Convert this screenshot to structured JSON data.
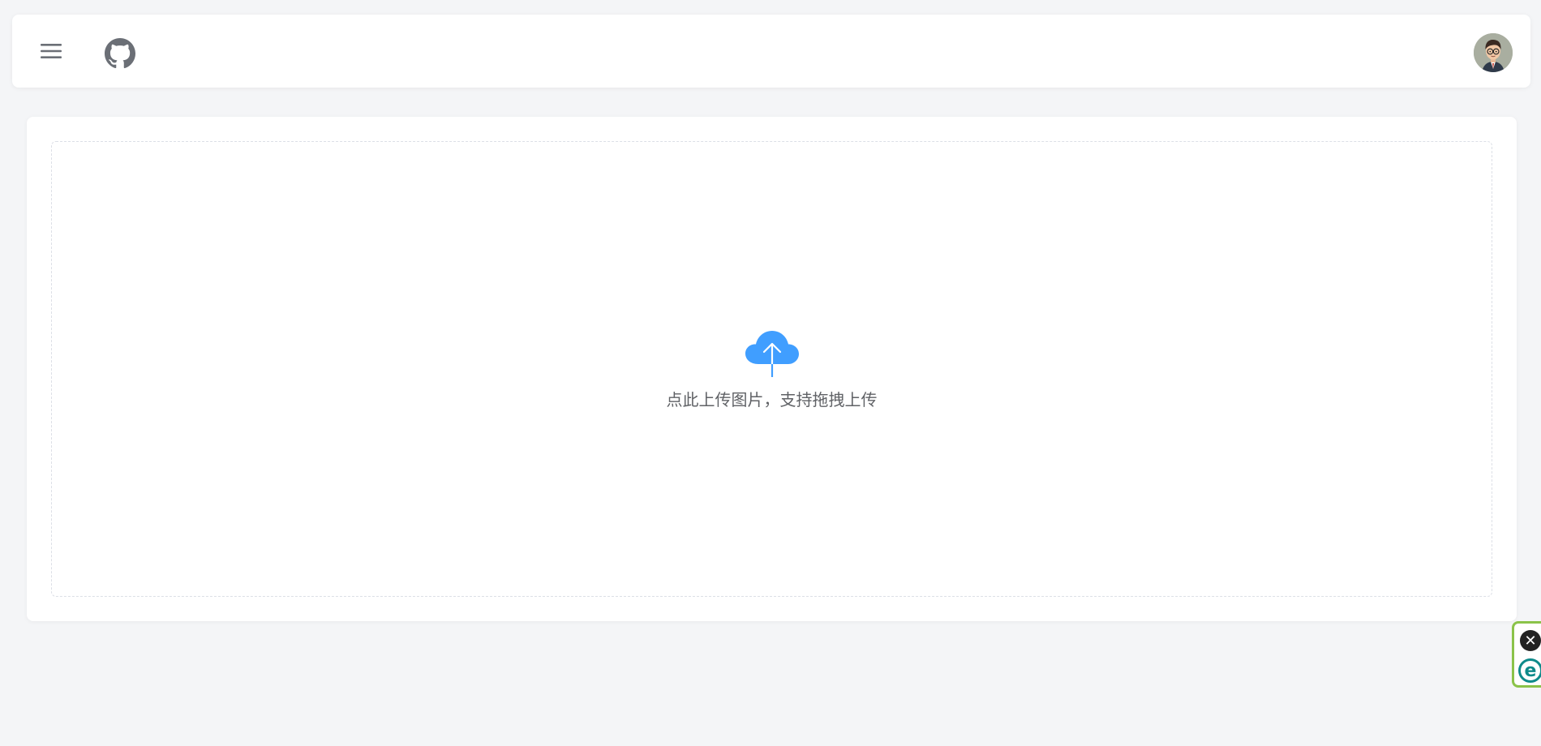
{
  "header": {
    "menu_icon": "hamburger-menu-icon",
    "github_icon": "github-icon",
    "avatar_icon": "user-avatar"
  },
  "upload": {
    "icon": "cloud-upload-icon",
    "hint": "点此上传图片，支持拖拽上传"
  },
  "extension": {
    "close_glyph": "✕",
    "logo_glyph": "e"
  },
  "colors": {
    "accent": "#409eff",
    "text": "#606266",
    "icon": "#6b6f76",
    "border": "#dcdfe6",
    "background": "#f4f5f7",
    "extension_border": "#8bc34a",
    "extension_logo": "#0e8a8a"
  }
}
